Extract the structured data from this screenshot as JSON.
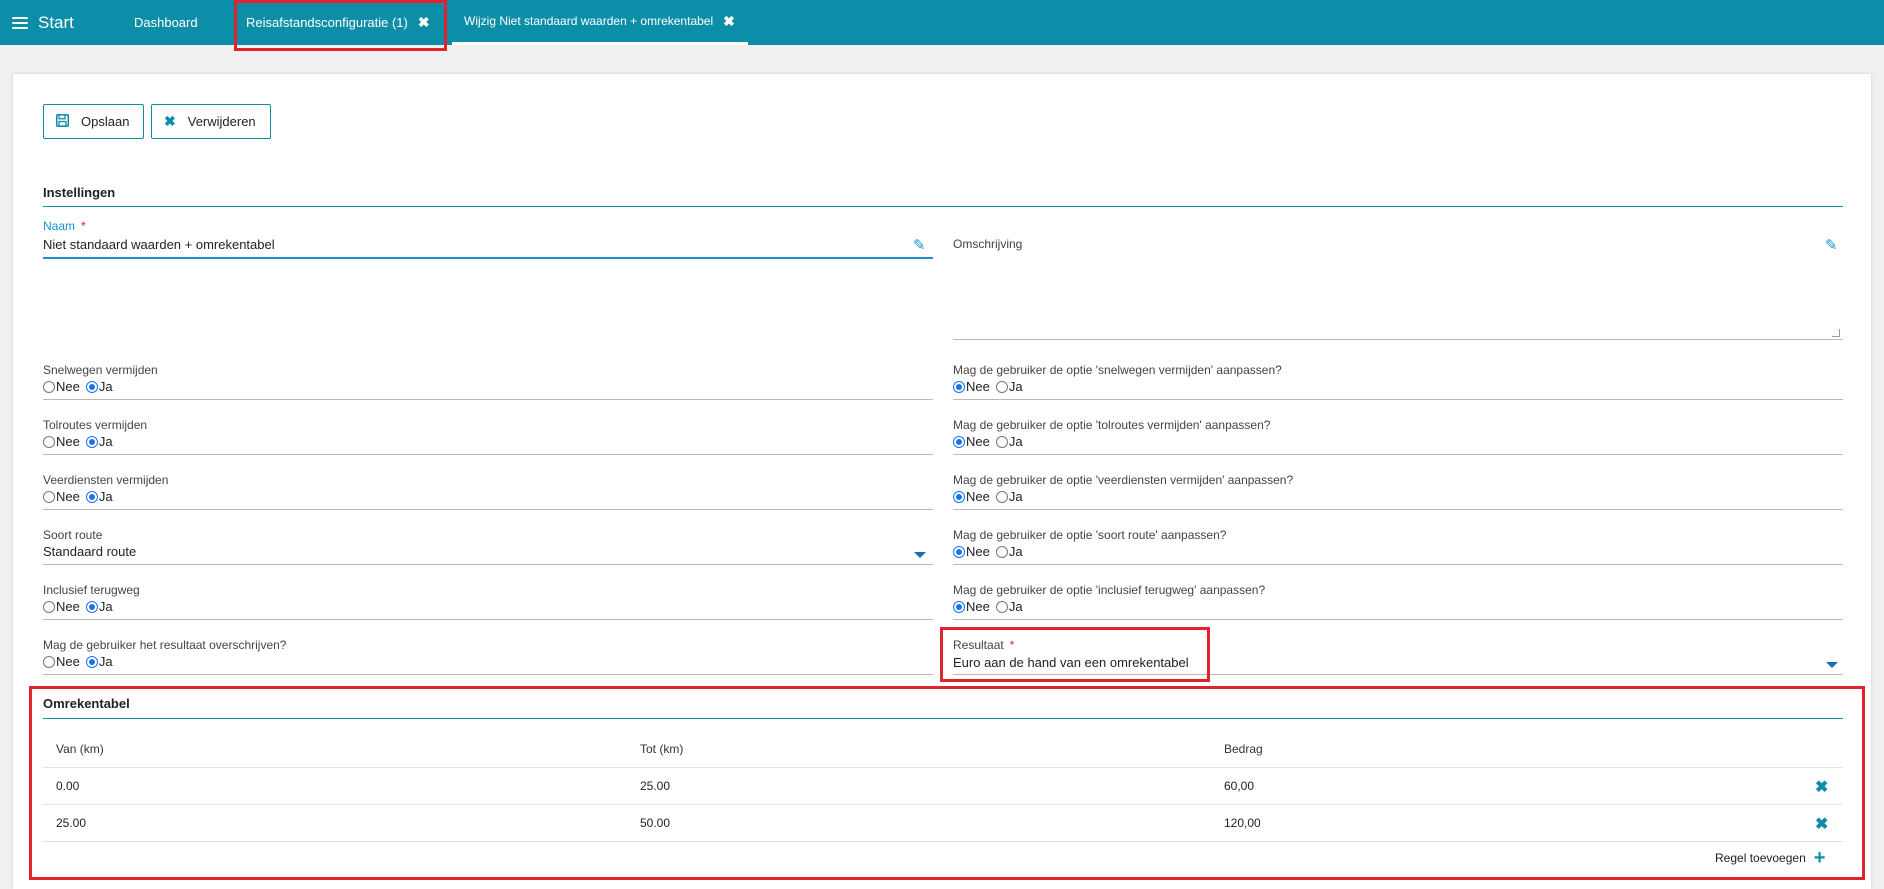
{
  "topbar": {
    "start_label": "Start",
    "tabs": [
      {
        "label": "Dashboard",
        "closable": false
      },
      {
        "label": "Reisafstandsconfiguratie (1)",
        "closable": true
      },
      {
        "label": "Wijzig Niet standaard waarden + omrekentabel",
        "closable": true
      }
    ],
    "close_glyph": "✖"
  },
  "toolbar": {
    "save_label": "Opslaan",
    "delete_label": "Verwijderen"
  },
  "settings": {
    "title": "Instellingen",
    "naam": {
      "label": "Naam",
      "required": "*",
      "value": "Niet standaard waarden + omrekentabel"
    },
    "omschrijving": {
      "label": "Omschrijving",
      "value": ""
    },
    "radio_nee": "Nee",
    "radio_ja": "Ja",
    "left": [
      {
        "label": "Snelwegen vermijden",
        "value": "Ja"
      },
      {
        "label": "Tolroutes vermijden",
        "value": "Ja"
      },
      {
        "label": "Veerdiensten vermijden",
        "value": "Ja"
      },
      {
        "label": "Soort route",
        "value": "Standaard route"
      },
      {
        "label": "Inclusief terugweg",
        "value": "Ja"
      },
      {
        "label": "Mag de gebruiker het resultaat overschrijven?",
        "value": "Ja"
      }
    ],
    "right": [
      {
        "label": "Mag de gebruiker de optie 'snelwegen vermijden' aanpassen?",
        "value": "Nee"
      },
      {
        "label": "Mag de gebruiker de optie 'tolroutes vermijden' aanpassen?",
        "value": "Nee"
      },
      {
        "label": "Mag de gebruiker de optie 'veerdiensten vermijden' aanpassen?",
        "value": "Nee"
      },
      {
        "label": "Mag de gebruiker de optie 'soort route' aanpassen?",
        "value": "Nee"
      },
      {
        "label": "Mag de gebruiker de optie 'inclusief terugweg' aanpassen?",
        "value": "Nee"
      }
    ],
    "resultaat": {
      "label": "Resultaat",
      "required": "*",
      "value": "Euro aan de hand van een omrekentabel"
    }
  },
  "omrekentabel": {
    "title": "Omrekentabel",
    "columns": [
      "Van (km)",
      "Tot (km)",
      "Bedrag"
    ],
    "rows": [
      {
        "van": "0.00",
        "tot": "25.00",
        "bedrag": "60,00"
      },
      {
        "van": "25.00",
        "tot": "50.00",
        "bedrag": "120,00"
      }
    ],
    "add_label": "Regel toevoegen"
  },
  "colors": {
    "accent": "#0d8ea8",
    "highlight": "#e0242f",
    "link_blue": "#1a8fcf"
  }
}
